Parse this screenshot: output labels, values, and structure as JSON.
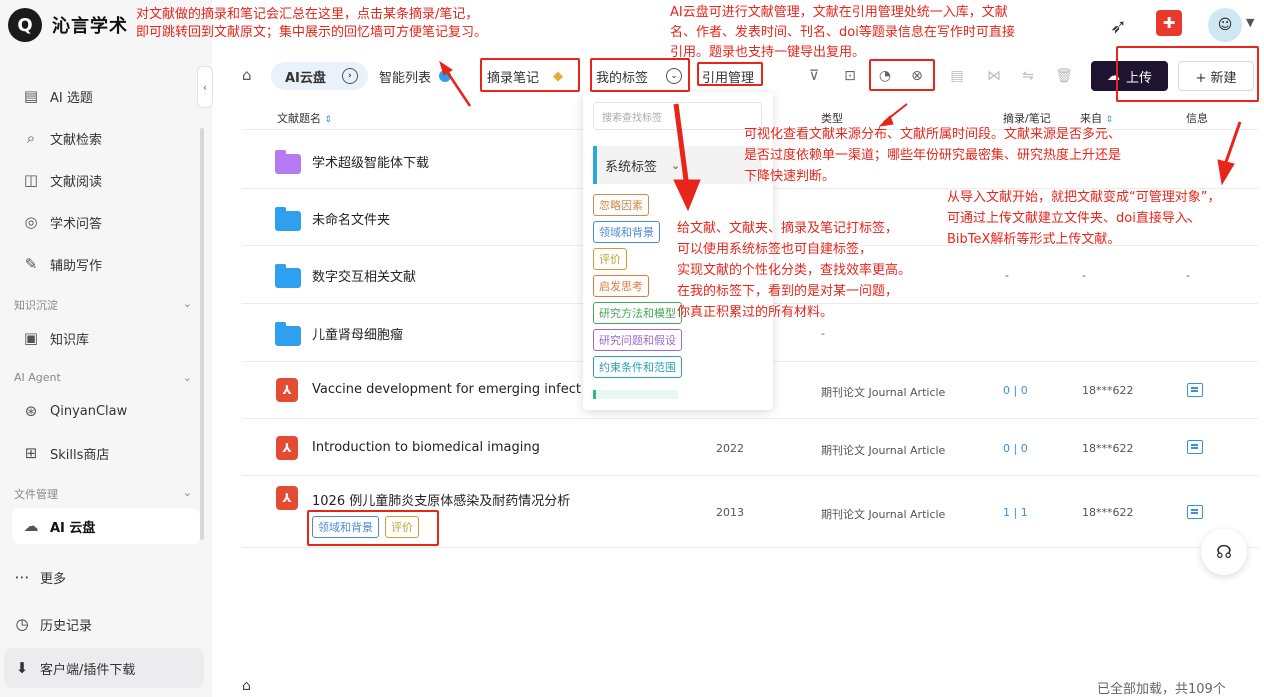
{
  "app": {
    "name": "沁言学术",
    "logo_glyph": "Q"
  },
  "sidebar": {
    "items": [
      {
        "label": "AI 选题",
        "icon": "document-icon"
      },
      {
        "label": "文献检索",
        "icon": "search-doc-icon"
      },
      {
        "label": "文献阅读",
        "icon": "book-icon"
      },
      {
        "label": "学术问答",
        "icon": "qa-icon"
      },
      {
        "label": "辅助写作",
        "icon": "pen-icon"
      }
    ],
    "section_knowledge": "知识沉淀",
    "knowledge_base": "知识库",
    "section_agent": "AI Agent",
    "qinyanclaw": "QinyanClaw",
    "skills_store": "Skills商店",
    "section_files": "文件管理",
    "ai_disk": "AI 云盘",
    "more": "更多",
    "history": "历史记录",
    "download": "客户端/插件下载"
  },
  "toolbar": {
    "tab_ai_disk": "AI云盘",
    "tab_smart_list": "智能列表",
    "tab_notes": "摘录笔记",
    "tab_my_tags": "我的标签",
    "tab_citation": "引用管理",
    "upload_label": "上传",
    "new_label": "+ 新建"
  },
  "table": {
    "headers": {
      "name": "文献题名",
      "type": "类型",
      "notes": "摘录/笔记",
      "source": "来自",
      "info": "信息"
    },
    "rows": [
      {
        "name": "学术超级智能体下载",
        "kind": "folder-purple"
      },
      {
        "name": "未命名文件夹",
        "kind": "folder",
        "notes": "-",
        "source": "-",
        "info": "-"
      },
      {
        "name": "数字交互相关文献",
        "kind": "folder",
        "notes": "-",
        "source": "-",
        "info": "-"
      },
      {
        "name": "儿童肾母细胞瘤",
        "kind": "folder",
        "type": "-"
      },
      {
        "name": "Vaccine development for emerging infectious",
        "kind": "pdf",
        "type": "期刊论文 Journal Article",
        "notes": "0 | 0",
        "source": "18***622"
      },
      {
        "name": "Introduction to biomedical imaging",
        "kind": "pdf",
        "year": "2022",
        "type": "期刊论文 Journal Article",
        "notes": "0 | 0",
        "source": "18***622"
      },
      {
        "name": "1026 例儿童肺炎支原体感染及耐药情况分析",
        "kind": "pdf",
        "year": "2013",
        "type": "期刊论文 Journal Article",
        "notes": "1 | 1",
        "source": "18***622",
        "tags": [
          "领域和背景",
          "评价"
        ]
      }
    ]
  },
  "dropdown": {
    "search_placeholder": "搜索查找标签",
    "system_tags_label": "系统标签",
    "tags": [
      {
        "label": "忽略因素",
        "color": "#d48a4a"
      },
      {
        "label": "领域和背景",
        "color": "#4c8ad8"
      },
      {
        "label": "评价",
        "color": "#c8a030"
      },
      {
        "label": "启发思考",
        "color": "#e07a40"
      },
      {
        "label": "研究方法和模型",
        "color": "#44a85a"
      },
      {
        "label": "研究问题和假设",
        "color": "#9a6ad0"
      },
      {
        "label": "约束条件和范围",
        "color": "#2aa0b8"
      }
    ]
  },
  "annotations": {
    "notes_tip_1": "对文献做的摘录和笔记会汇总在这里，点击某条摘录/笔记，",
    "notes_tip_2": "即可跳转回到文献原文；集中展示的回忆墙可方便笔记复习。",
    "disk_tip_1": "AI云盘可进行文献管理，文献在引用管理处统一入库，文献",
    "disk_tip_2": "名、作者、发表时间、刊名、doi等题录信息在写作时可直接",
    "disk_tip_3": "引用。题录也支持一键导出复用。",
    "viz_tip_1": "可视化查看文献来源分布、文献所属时间段。文献来源是否多元、",
    "viz_tip_2": "是否过度依赖单一渠道；哪些年份研究最密集、研究热度上升还是",
    "viz_tip_3": "下降快速判断。",
    "upload_tip_1": "从导入文献开始，就把文献变成“可管理对象”，",
    "upload_tip_2": "可通过上传文献建立文件夹、doi直接导入、",
    "upload_tip_3": "BibTeX解析等形式上传文献。",
    "tag_tip_1": "给文献、文献夹、摘录及笔记打标签，",
    "tag_tip_2": "可以使用系统标签也可自建标签，",
    "tag_tip_3": "实现文献的个性化分类，查找效率更高。",
    "tag_tip_4": "在我的标签下，看到的是对某一问题，",
    "tag_tip_5": "你真正积累过的所有材料。"
  },
  "footer": {
    "status": "已全部加载，共109个"
  },
  "colors": {
    "accent_red": "#e8251a",
    "brand_dark": "#1e1431",
    "link_blue": "#3891db"
  }
}
